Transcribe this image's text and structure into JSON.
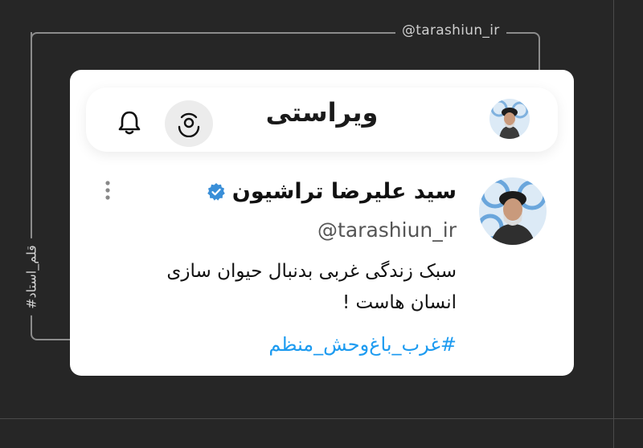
{
  "frame": {
    "top_handle": "@tarashiun_ir",
    "side_tag": "#قلم_استاد"
  },
  "header": {
    "brand": "ویراستی",
    "icons": [
      "bell-icon",
      "profile-scan-icon"
    ]
  },
  "post": {
    "display_name": "سید علیرضا تراشیون",
    "verified": true,
    "handle": "@tarashiun_ir",
    "text_line1": "سبک زندگی غربی بدنبال حیوان سازی",
    "text_line2": "انسان هاست !",
    "hashtag": "#غرب_باغ‌وحش_منظم"
  },
  "colors": {
    "background": "#262626",
    "card": "#ffffff",
    "hashtag": "#1d9bf0",
    "verified": "#3a8fd8"
  }
}
